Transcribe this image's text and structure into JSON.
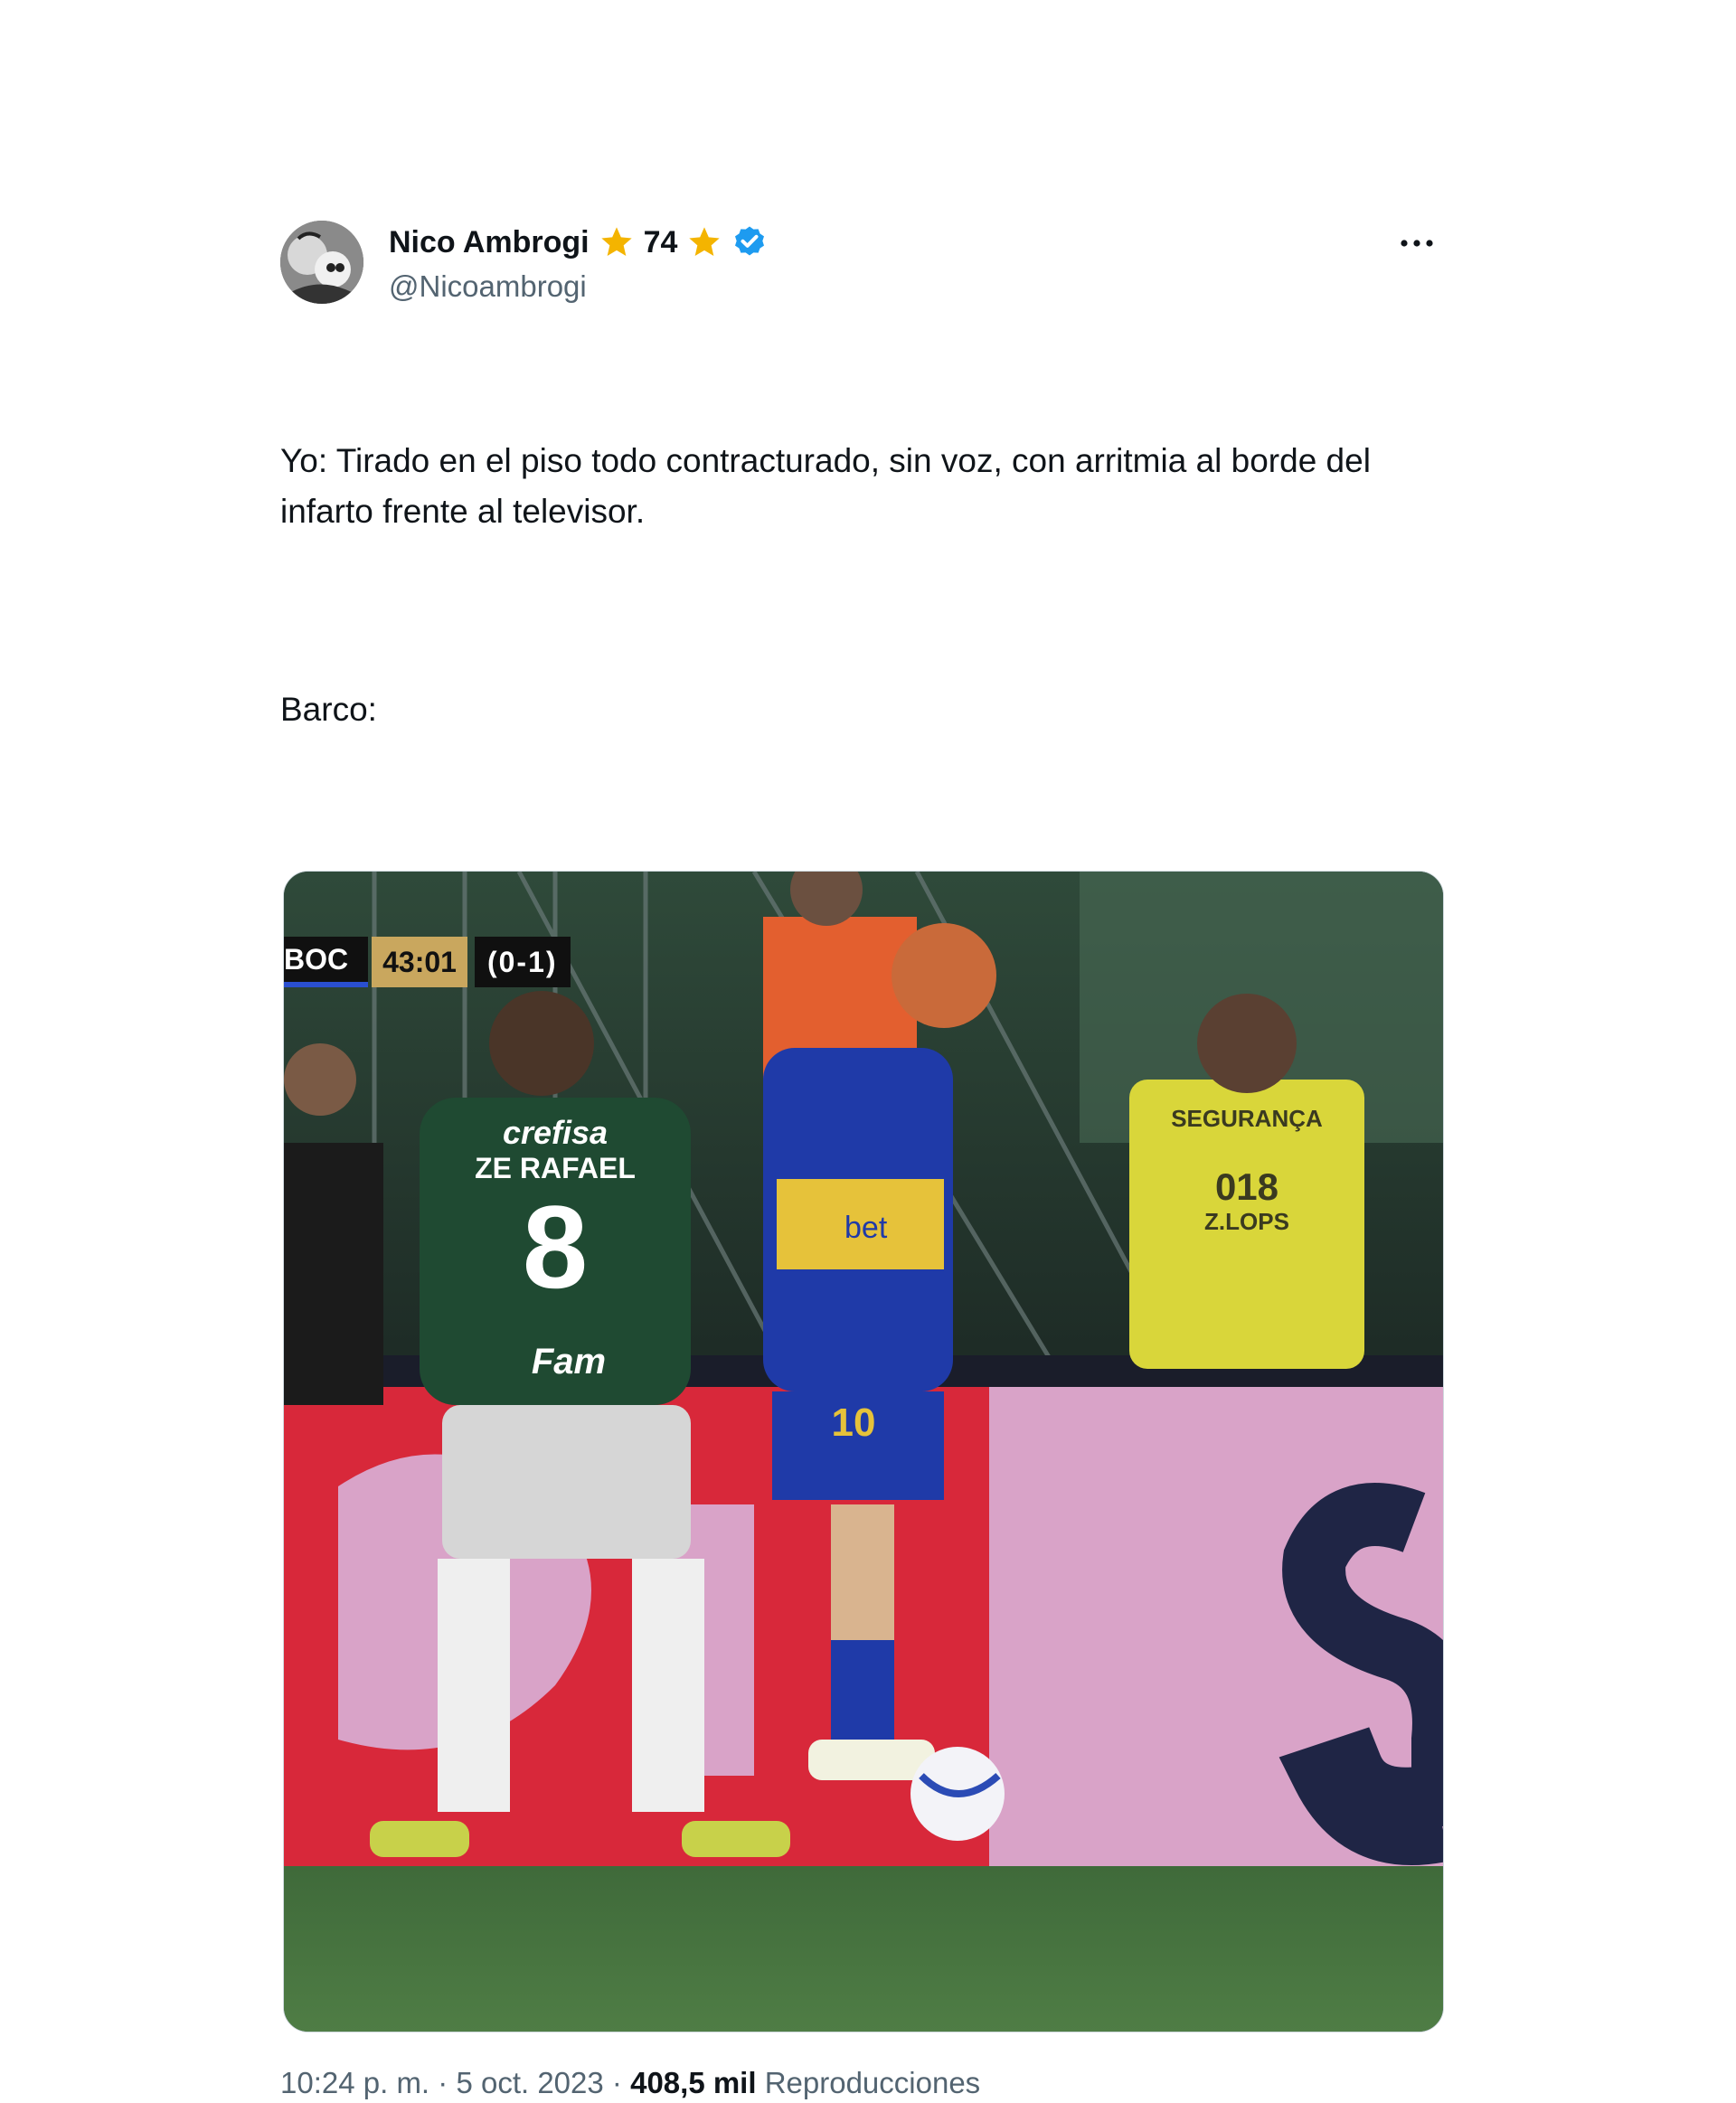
{
  "tweet": {
    "author_name": "Nico Ambrogi",
    "author_number": "74",
    "handle": "@Nicoambrogi",
    "text_paragraph_1": "Yo: Tirado en el piso todo contracturado, sin voz, con arritmia al borde del infarto frente al televisor.",
    "text_paragraph_2": "Barco:",
    "time": "10:24 p. m.",
    "date": "5 oct. 2023",
    "separator": "·",
    "views_count": "408,5 mil",
    "views_label": "Reproducciones"
  },
  "media": {
    "scoreboard": {
      "team": "BOC",
      "clock": "43:01",
      "score": "(0-1)"
    },
    "jersey_left": {
      "sponsor": "crefisa",
      "player_name": "ZE RAFAEL",
      "number": "8",
      "lower_sponsor": "Fam"
    },
    "jersey_right": {
      "number": "10",
      "sponsor": "bet"
    },
    "security_vest": {
      "title": "SEGURANÇA",
      "number": "018",
      "company": "Z.LOPS"
    }
  },
  "icons": {
    "star": "star-icon",
    "verified": "verified-badge-icon",
    "more": "more-options-icon"
  },
  "colors": {
    "star": "#f4b400",
    "verified": "#1d9bf0",
    "secondary_text": "#536471"
  }
}
